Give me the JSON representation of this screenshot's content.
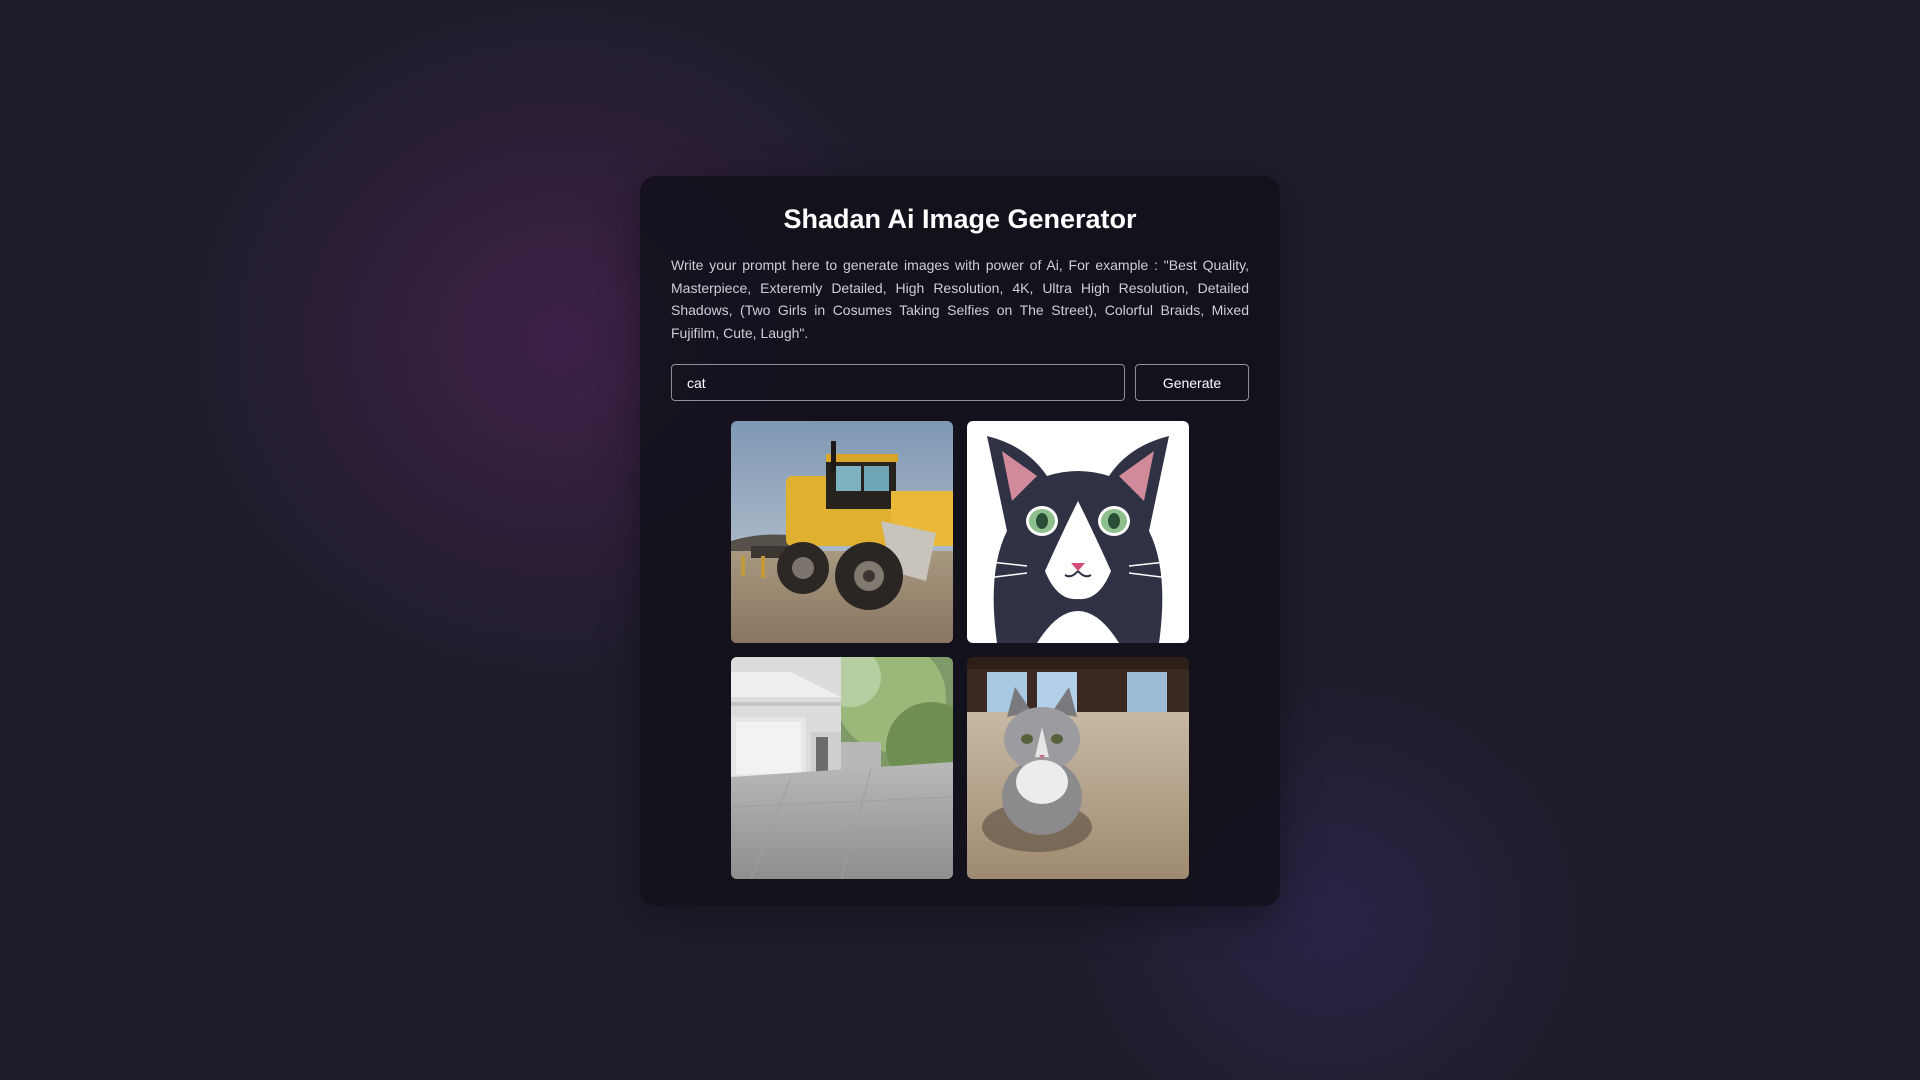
{
  "app": {
    "title": "Shadan Ai Image Generator",
    "description": "Write your prompt here to generate images with power of Ai, For example : \"Best Quality, Masterpiece, Exteremly Detailed, High Resolution, 4K, Ultra High Resolution, Detailed Shadows, (Two Girls in Cosumes Taking Selfies on The Street), Colorful Braids, Mixed Fujifilm, Cute, Laugh\"."
  },
  "prompt": {
    "value": "cat",
    "placeholder": ""
  },
  "generate_button": {
    "label": "Generate"
  },
  "results": [
    {
      "icon": "tractor-photo"
    },
    {
      "icon": "cartoon-cat-illustration"
    },
    {
      "icon": "house-driveway-photo"
    },
    {
      "icon": "gray-cat-photo"
    }
  ],
  "colors": {
    "background": "#1f1d2c",
    "card": "#12101a",
    "border": "#8f8c9c",
    "text": "#ffffff",
    "muted_text": "#cfcdd8"
  }
}
